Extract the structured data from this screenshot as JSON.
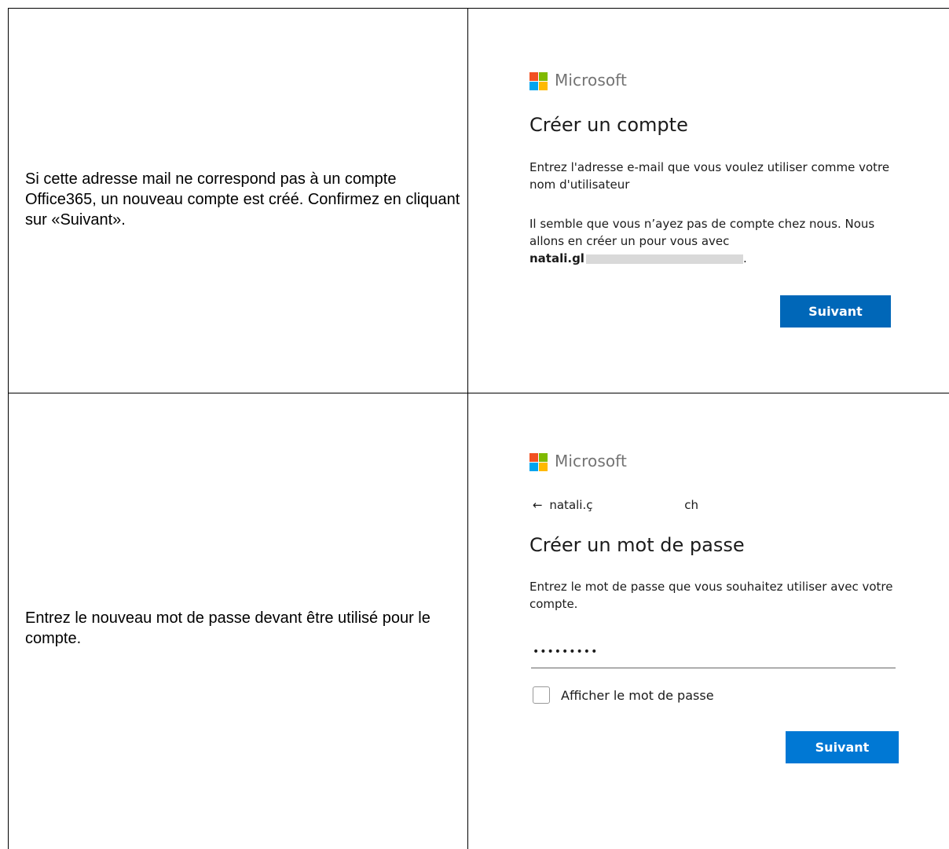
{
  "rows": [
    {
      "instruction": "Si cette adresse mail ne correspond pas à un compte Office365, un nouveau compte est créé. Confirmez en cliquant sur «Suivant».",
      "brand": "Microsoft",
      "title": "Créer un compte",
      "intro": "Entrez l'adresse e-mail que vous voulez utiliser comme votre nom d'utilisateur",
      "message": "Il semble que vous n’ayez pas de compte chez nous. Nous allons en créer un pour vous avec",
      "email_visible": "natali.gl",
      "email_end": ".",
      "button": "Suivant"
    },
    {
      "instruction": "Entrez le nouveau mot de passe devant être utilisé pour le compte.",
      "brand": "Microsoft",
      "back_arrow": "←",
      "back_email_start": "natali.ç",
      "back_email_end": "ch",
      "title": "Créer un mot de passe",
      "intro": "Entrez le mot de passe que vous souhaitez utiliser avec votre compte.",
      "password_value": "•••••••••",
      "checkbox_label": "Afficher le mot de passe",
      "button": "Suivant"
    }
  ]
}
